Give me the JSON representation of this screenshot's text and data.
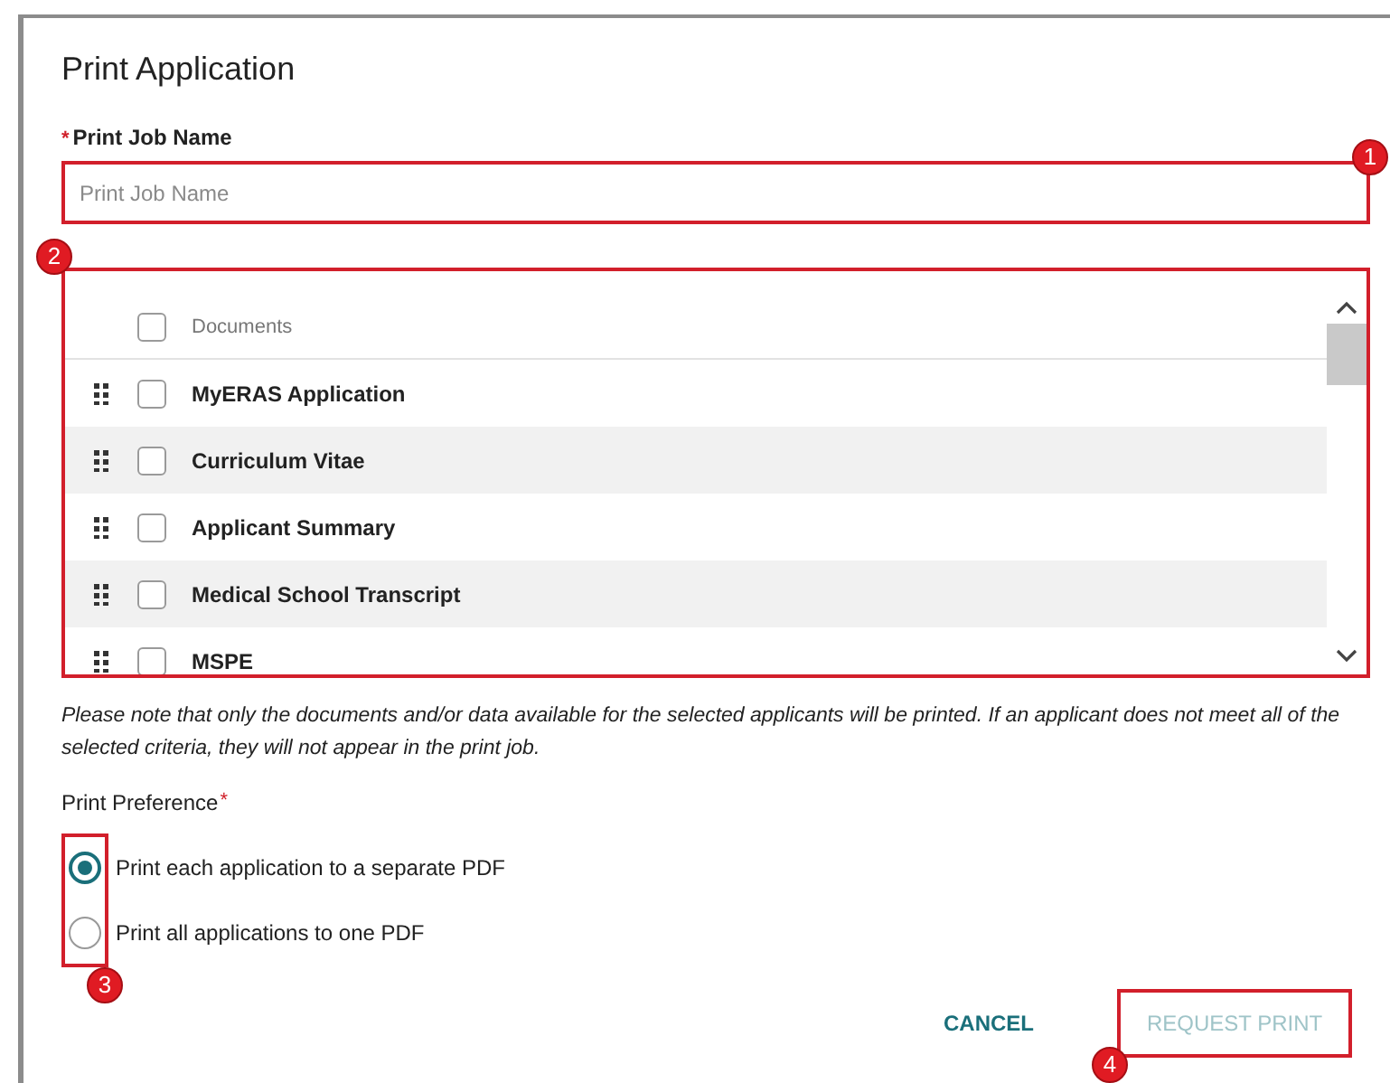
{
  "dialog": {
    "title": "Print Application"
  },
  "job_name": {
    "required_mark": "*",
    "label": "Print Job Name",
    "placeholder": "Print Job Name",
    "callout": "1"
  },
  "documents": {
    "callout": "2",
    "header": {
      "label": "Documents",
      "checked": false
    },
    "rows": [
      {
        "label": "MyERAS Application",
        "checked": false
      },
      {
        "label": "Curriculum Vitae",
        "checked": false
      },
      {
        "label": "Applicant Summary",
        "checked": false
      },
      {
        "label": "Medical School Transcript",
        "checked": false
      },
      {
        "label": "MSPE",
        "checked": false
      }
    ]
  },
  "note": "Please note that only the documents and/or data available for the selected applicants will be printed. If an applicant does not meet all of the selected criteria, they will not appear in the print job.",
  "print_preference": {
    "label": "Print Preference",
    "required_mark": "*",
    "callout": "3",
    "options": [
      {
        "label": "Print each application to a separate PDF",
        "selected": true
      },
      {
        "label": "Print all applications to one PDF",
        "selected": false
      }
    ]
  },
  "actions": [
    {
      "label": "CANCEL",
      "kind": "text",
      "disabled": false
    },
    {
      "label": "REQUEST PRINT",
      "kind": "outlined",
      "disabled": true,
      "callout": "4"
    }
  ]
}
